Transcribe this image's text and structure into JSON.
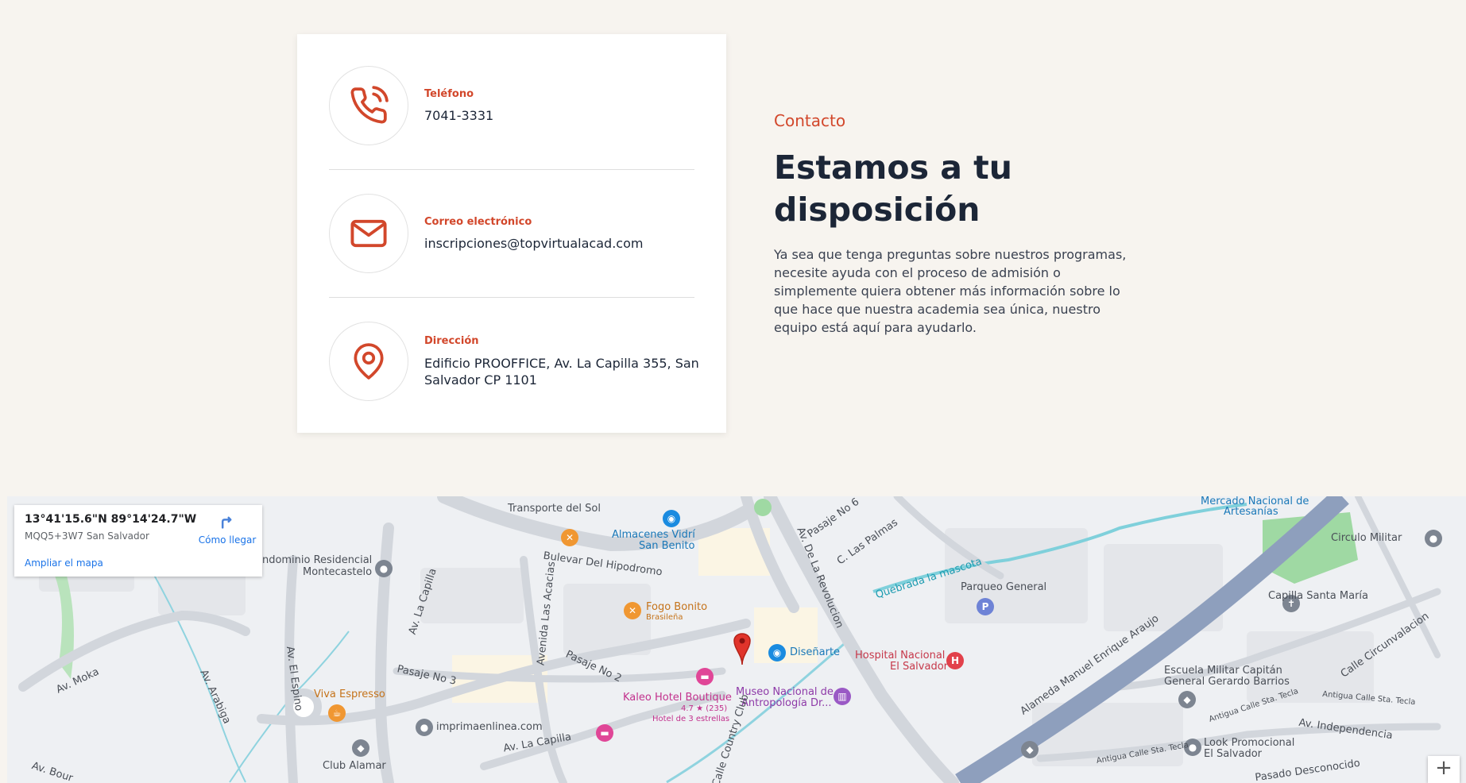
{
  "contact_card": {
    "phone": {
      "label": "Teléfono",
      "value": "7041-3331",
      "icon": "phone-icon"
    },
    "email": {
      "label": "Correo electrónico",
      "value": "inscripciones@topvirtualacad.com",
      "icon": "mail-icon"
    },
    "address": {
      "label": "Dirección",
      "value": "Edificio PROOFFICE, Av. La Capilla 355, San Salvador CP 1101",
      "icon": "location-pin-icon"
    }
  },
  "intro": {
    "eyebrow": "Contacto",
    "headline": "Estamos a tu disposición",
    "description": "Ya sea que tenga preguntas sobre nuestros programas, necesite ayuda con el proceso de admisión o simplemente quiera obtener más información sobre lo que hace que nuestra academia sea única, nuestro equipo está aquí para ayudarlo."
  },
  "map": {
    "infobox": {
      "coordinates": "13°41'15.6\"N 89°14'24.7\"W",
      "plus_code": "MQQ5+3W7 San Salvador",
      "directions_label": "Cómo llegar",
      "enlarge_label": "Ampliar el mapa"
    },
    "zoom_in": "+",
    "labels": {
      "transporte": "Transporte del Sol",
      "almacenes": "Almacenes Vidrí",
      "san_benito": "San Benito",
      "bulevar": "Bulevar Del Hipodromo",
      "condominio1": "ondominio Residencial",
      "condominio2": "Montecastelo",
      "fogo": "Fogo Bonito",
      "fogo_sub": "Brasileña",
      "av_capilla": "Av. La Capilla",
      "av_acacias": "Avenida Las Acacias",
      "pasaje2": "Pasaje No 2",
      "pasaje3": "Pasaje No 3",
      "pasaje6": "Pasaje No 6",
      "av_moka": "Av. Moka",
      "av_arabiga": "Av. Arabiga",
      "av_espino": "Av. El Espino",
      "viva": "Viva Espresso",
      "imprima": "imprimaenlinea.com",
      "club": "Club Alamar",
      "av_capilla2": "Av. La Capilla",
      "kaleo": "Kaleo Hotel Boutique",
      "kaleo_rating": "4.7 ★ (235)",
      "kaleo_sub": "Hotel de 3 estrellas",
      "museo1": "Museo Nacional de",
      "museo2": "Antropología Dr...",
      "disenarte": "Diseñarte",
      "hospital1": "Hospital Nacional",
      "hospital2": "El Salvador",
      "revolucion": "Av. De La Revolucion",
      "las_palmas": "C. Las Palmas",
      "quebrada": "Quebrada la mascota",
      "parqueo": "Parqueo General",
      "mercado1": "Mercado Nacional de",
      "mercado2": "Artesanías",
      "circulo": "Circulo Militar",
      "capilla_sm": "Capilla Santa María",
      "escuela1": "Escuela Militar Capitán",
      "escuela2": "General Gerardo Barrios",
      "alameda": "Alameda Manuel Enrique Araujo",
      "circunvalacion": "Calle Circunvalacion",
      "tecla1": "Antigua Calle Sta. Tecla",
      "tecla2": "Antigua Calle Sta. Tecla",
      "independencia": "Av. Independencia",
      "look1": "Look Promocional",
      "look2": "El Salvador",
      "tecla3": "Antigua Calle Sta. Tecla",
      "desconocido": "Pasado Desconocido",
      "country": "Calle Country Club",
      "av_bour": "Av. Bour"
    }
  },
  "colors": {
    "accent": "#d2472b",
    "heading": "#1c2637",
    "background": "#f7f4ef"
  }
}
